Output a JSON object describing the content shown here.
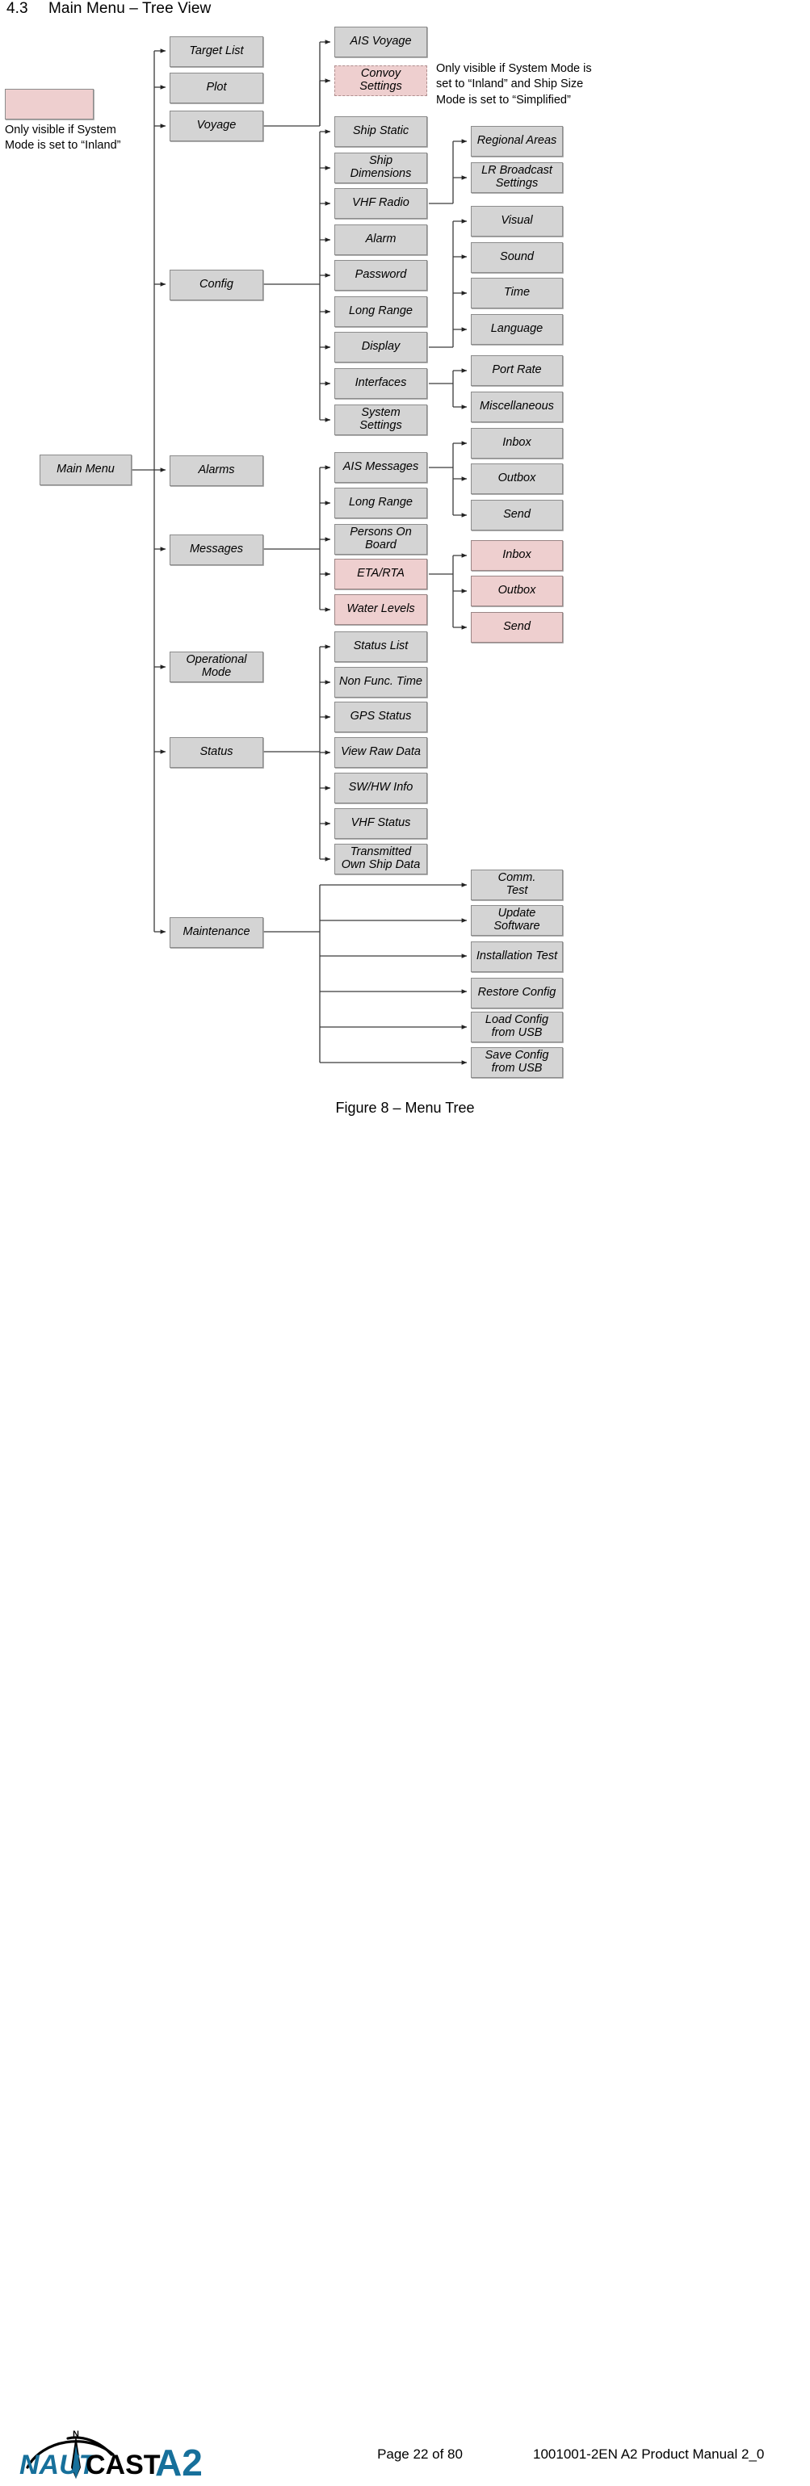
{
  "heading": {
    "number": "4.3",
    "title": "Main Menu – Tree View"
  },
  "legend": {
    "note": "Only visible if System\nMode is set to “Inland”"
  },
  "notes": {
    "convoy": "Only visible if System Mode is\nset to “Inland” and Ship Size\nMode is set to “Simplified”"
  },
  "tree": {
    "root": {
      "label": "Main Menu"
    },
    "level1": [
      {
        "label": "Target List",
        "style": "grey"
      },
      {
        "label": "Plot",
        "style": "grey"
      },
      {
        "label": "Voyage",
        "style": "grey"
      },
      {
        "label": "Config",
        "style": "grey"
      },
      {
        "label": "Alarms",
        "style": "grey"
      },
      {
        "label": "Messages",
        "style": "grey"
      },
      {
        "label": "Operational\nMode",
        "style": "grey"
      },
      {
        "label": "Status",
        "style": "grey"
      },
      {
        "label": "Maintenance",
        "style": "grey"
      }
    ],
    "level2": [
      {
        "label": "AIS Voyage",
        "style": "grey",
        "parent": "Voyage"
      },
      {
        "label": "Convoy\nSettings",
        "style": "pink-dashed",
        "parent": "Voyage"
      },
      {
        "label": "Ship Static",
        "style": "grey",
        "parent": "Config"
      },
      {
        "label": "Ship\nDimensions",
        "style": "grey",
        "parent": "Config"
      },
      {
        "label": "VHF Radio",
        "style": "grey",
        "parent": "Config"
      },
      {
        "label": "Alarm",
        "style": "grey",
        "parent": "Config"
      },
      {
        "label": "Password",
        "style": "grey",
        "parent": "Config"
      },
      {
        "label": "Long Range",
        "style": "grey",
        "parent": "Config"
      },
      {
        "label": "Display",
        "style": "grey",
        "parent": "Config"
      },
      {
        "label": "Interfaces",
        "style": "grey",
        "parent": "Config"
      },
      {
        "label": "System\nSettings",
        "style": "grey",
        "parent": "Config"
      },
      {
        "label": "AIS Messages",
        "style": "grey",
        "parent": "Messages"
      },
      {
        "label": "Long Range",
        "style": "grey",
        "parent": "Messages"
      },
      {
        "label": "Persons On\nBoard",
        "style": "grey",
        "parent": "Messages"
      },
      {
        "label": "ETA/RTA",
        "style": "pink",
        "parent": "Messages"
      },
      {
        "label": "Water Levels",
        "style": "pink",
        "parent": "Messages"
      },
      {
        "label": "Status List",
        "style": "grey",
        "parent": "Status"
      },
      {
        "label": "Non Func. Time",
        "style": "grey",
        "parent": "Status"
      },
      {
        "label": "GPS Status",
        "style": "grey",
        "parent": "Status"
      },
      {
        "label": "View Raw Data",
        "style": "grey",
        "parent": "Status"
      },
      {
        "label": "SW/HW Info",
        "style": "grey",
        "parent": "Status"
      },
      {
        "label": "VHF Status",
        "style": "grey",
        "parent": "Status"
      },
      {
        "label": "Transmitted\nOwn Ship Data",
        "style": "grey",
        "parent": "Status"
      }
    ],
    "level3": [
      {
        "label": "Regional Areas",
        "style": "grey",
        "parent": "VHF Radio"
      },
      {
        "label": "LR Broadcast\nSettings",
        "style": "grey",
        "parent": "VHF Radio"
      },
      {
        "label": "Visual",
        "style": "grey",
        "parent": "Display"
      },
      {
        "label": "Sound",
        "style": "grey",
        "parent": "Display"
      },
      {
        "label": "Time",
        "style": "grey",
        "parent": "Display"
      },
      {
        "label": "Language",
        "style": "grey",
        "parent": "Display"
      },
      {
        "label": "Port Rate",
        "style": "grey",
        "parent": "Interfaces"
      },
      {
        "label": "Miscellaneous",
        "style": "grey",
        "parent": "Interfaces"
      },
      {
        "label": "Inbox",
        "style": "grey",
        "parent": "AIS Messages"
      },
      {
        "label": "Outbox",
        "style": "grey",
        "parent": "AIS Messages"
      },
      {
        "label": "Send",
        "style": "grey",
        "parent": "AIS Messages"
      },
      {
        "label": "Inbox",
        "style": "pink",
        "parent": "ETA/RTA"
      },
      {
        "label": "Outbox",
        "style": "pink",
        "parent": "ETA/RTA"
      },
      {
        "label": "Send",
        "style": "pink",
        "parent": "ETA/RTA"
      },
      {
        "label": "Comm.\nTest",
        "style": "grey",
        "parent": "Maintenance"
      },
      {
        "label": "Update\nSoftware",
        "style": "grey",
        "parent": "Maintenance"
      },
      {
        "label": "Installation Test",
        "style": "grey",
        "parent": "Maintenance"
      },
      {
        "label": "Restore Config",
        "style": "grey",
        "parent": "Maintenance"
      },
      {
        "label": "Load Config\nfrom USB",
        "style": "grey",
        "parent": "Maintenance"
      },
      {
        "label": "Save Config\nfrom USB",
        "style": "grey",
        "parent": "Maintenance"
      }
    ]
  },
  "figure_caption": "Figure 8 – Menu Tree",
  "footer": {
    "logo_text_1": "NAUT",
    "logo_text_2": "CAST",
    "logo_text_3": "A2",
    "logo_compass_letter": "N",
    "page": "Page 22 of 80",
    "doc_ref": "1001001-2EN A2 Product Manual 2_0"
  },
  "colors": {
    "node_fill": "#d4d4d4",
    "node_border": "#8c8c8c",
    "pink_fill": "#eecfcf",
    "logo_blue": "#17709b",
    "line": "#3a3a3a"
  }
}
